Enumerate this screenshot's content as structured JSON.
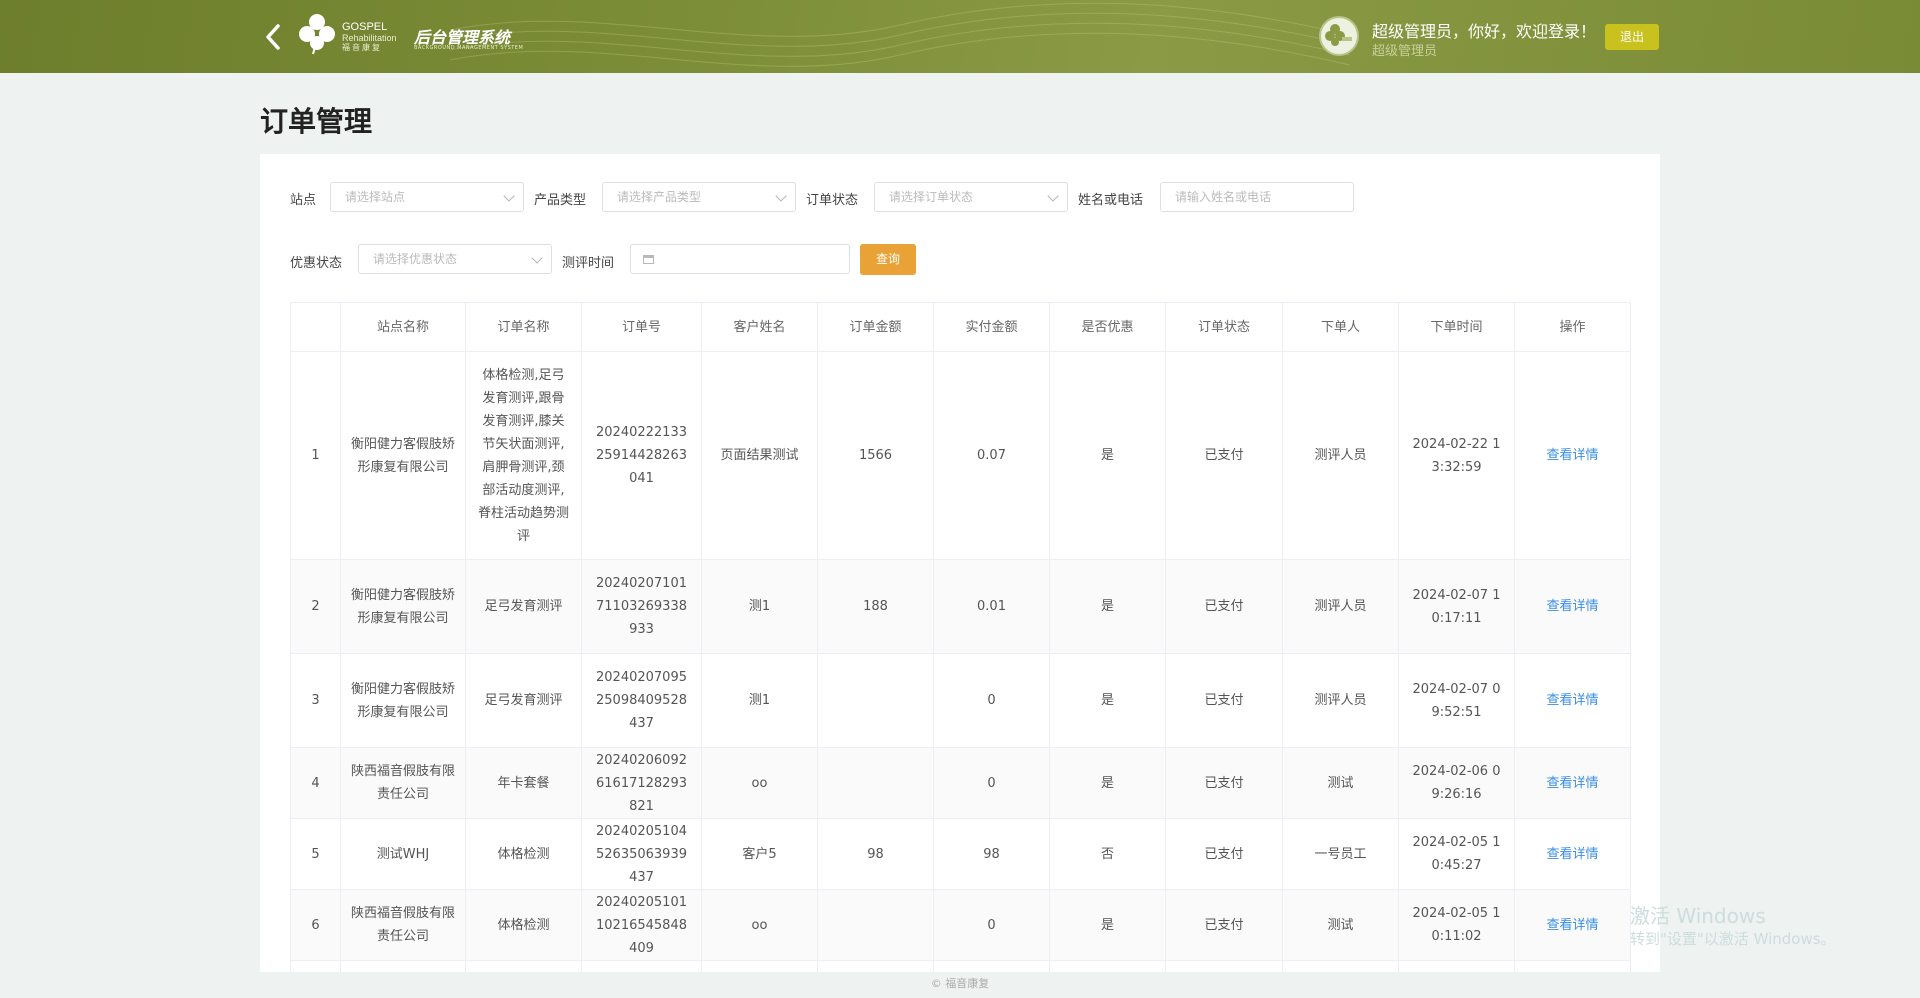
{
  "header": {
    "logo_en": "GOSPEL",
    "logo_en2": "Rehabilitation",
    "logo_cn": "福音康复",
    "system_title": "后台管理系统",
    "system_subtitle": "BACKGROUND MANAGEMENT SYSTEM",
    "welcome": "超级管理员，你好，欢迎登录！",
    "role": "超级管理员",
    "logout_label": "退出"
  },
  "page_title": "订单管理",
  "filters": {
    "site_label": "站点",
    "site_placeholder": "请选择站点",
    "product_label": "产品类型",
    "product_placeholder": "请选择产品类型",
    "order_status_label": "订单状态",
    "order_status_placeholder": "请选择订单状态",
    "name_phone_label": "姓名或电话",
    "name_phone_placeholder": "请输入姓名或电话",
    "discount_label": "优惠状态",
    "discount_placeholder": "请选择优惠状态",
    "eval_time_label": "测评时间",
    "query_label": "查询"
  },
  "table": {
    "columns": [
      "",
      "站点名称",
      "订单名称",
      "订单号",
      "客户姓名",
      "订单金额",
      "实付金额",
      "是否优惠",
      "订单状态",
      "下单人",
      "下单时间",
      "操作"
    ],
    "rows": [
      {
        "no": "1",
        "site": "衡阳健力客假肢矫形康复有限公司",
        "name": "体格检测,足弓发育测评,跟骨发育测评,膝关节矢状面测评,肩胛骨测评,颈部活动度测评,脊柱活动趋势测评",
        "order_no": "2024022213325914428263041",
        "customer": "页面结果测试",
        "amount": "1566",
        "paid": "0.07",
        "discount": "是",
        "status": "已支付",
        "creator": "测评人员",
        "time": "2024-02-22 13:32:59",
        "action": "查看详情"
      },
      {
        "no": "2",
        "site": "衡阳健力客假肢矫形康复有限公司",
        "name": "足弓发育测评",
        "order_no": "2024020710171103269338933",
        "customer": "测1",
        "amount": "188",
        "paid": "0.01",
        "discount": "是",
        "status": "已支付",
        "creator": "测评人员",
        "time": "2024-02-07 10:17:11",
        "action": "查看详情"
      },
      {
        "no": "3",
        "site": "衡阳健力客假肢矫形康复有限公司",
        "name": "足弓发育测评",
        "order_no": "2024020709525098409528437",
        "customer": "测1",
        "amount": "",
        "paid": "0",
        "discount": "是",
        "status": "已支付",
        "creator": "测评人员",
        "time": "2024-02-07 09:52:51",
        "action": "查看详情"
      },
      {
        "no": "4",
        "site": "陕西福音假肢有限责任公司",
        "name": "年卡套餐",
        "order_no": "2024020609261617128293821",
        "customer": "oo",
        "amount": "",
        "paid": "0",
        "discount": "是",
        "status": "已支付",
        "creator": "测试",
        "time": "2024-02-06 09:26:16",
        "action": "查看详情"
      },
      {
        "no": "5",
        "site": "测试WHJ",
        "name": "体格检测",
        "order_no": "2024020510452635063939437",
        "customer": "客户5",
        "amount": "98",
        "paid": "98",
        "discount": "否",
        "status": "已支付",
        "creator": "一号员工",
        "time": "2024-02-05 10:45:27",
        "action": "查看详情"
      },
      {
        "no": "6",
        "site": "陕西福音假肢有限责任公司",
        "name": "体格检测",
        "order_no": "2024020510110216545848409",
        "customer": "oo",
        "amount": "",
        "paid": "0",
        "discount": "是",
        "status": "已支付",
        "creator": "测试",
        "time": "2024-02-05 10:11:02",
        "action": "查看详情"
      }
    ]
  },
  "footer": "© 福音康复",
  "watermark": {
    "line1": "激活 Windows",
    "line2": "转到\"设置\"以激活 Windows。"
  }
}
